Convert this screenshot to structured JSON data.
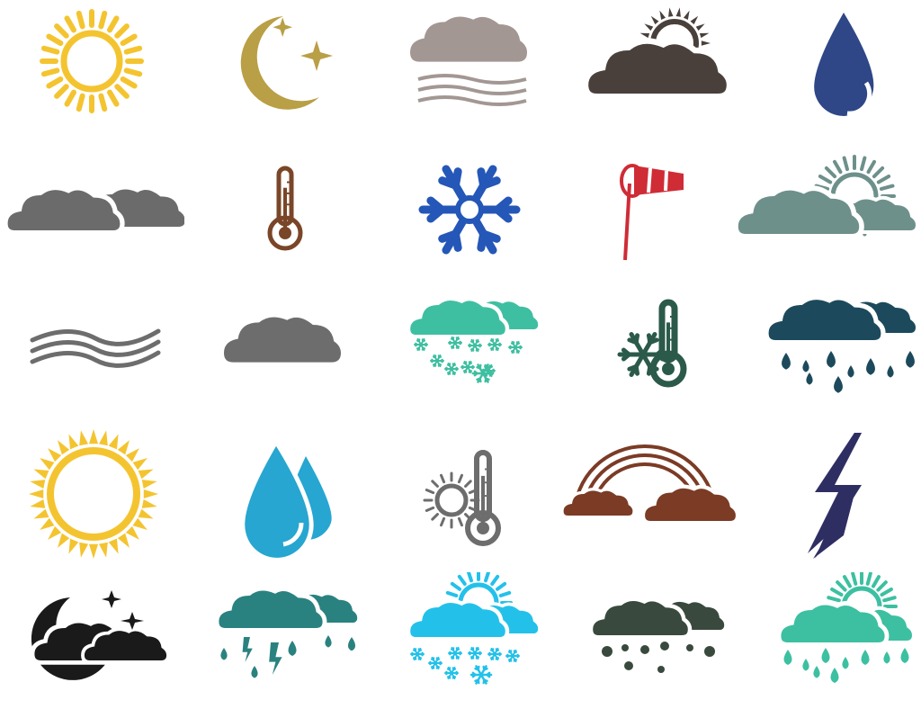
{
  "sheet": {
    "background": "#ffffff",
    "rows": 5,
    "columns": 5
  },
  "icons": [
    {
      "name": "sun-icon",
      "color": "#f4c430"
    },
    {
      "name": "crescent-moon-stars-icon",
      "color": "#b99f45"
    },
    {
      "name": "fog-cloud-icon",
      "color": "#a39793"
    },
    {
      "name": "cloud-sun-icon",
      "color": "#4a403b"
    },
    {
      "name": "water-drop-icon",
      "color": "#2f4687"
    },
    {
      "name": "overcast-clouds-icon",
      "color": "#6b6b6b"
    },
    {
      "name": "thermometer-icon",
      "color": "#7a4628"
    },
    {
      "name": "snowflake-icon",
      "color": "#2457b7"
    },
    {
      "name": "windsock-icon",
      "color": "#cf2c36"
    },
    {
      "name": "partly-cloudy-icon",
      "color": "#6e908b"
    },
    {
      "name": "wind-waves-icon",
      "color": "#6d6d6d"
    },
    {
      "name": "cloud-icon",
      "color": "#6d6d6d"
    },
    {
      "name": "snowy-clouds-icon",
      "color": "#3fbfa1"
    },
    {
      "name": "frost-thermometer-icon",
      "color": "#2b5a4a"
    },
    {
      "name": "rainy-clouds-icon",
      "color": "#1c4a5c"
    },
    {
      "name": "bright-sun-icon",
      "color": "#f4c430"
    },
    {
      "name": "water-drops-icon",
      "color": "#26a6d1"
    },
    {
      "name": "sun-thermometer-icon",
      "color": "#6d6d6d"
    },
    {
      "name": "rainbow-clouds-icon",
      "color": "#7b3b25"
    },
    {
      "name": "lightning-bolt-icon",
      "color": "#2f2e63"
    },
    {
      "name": "night-cloud-moon-icon",
      "color": "#1a1a1a"
    },
    {
      "name": "thunderstorm-rain-icon",
      "color": "#2a8280"
    },
    {
      "name": "sun-snow-clouds-icon",
      "color": "#23c1ea"
    },
    {
      "name": "hail-clouds-icon",
      "color": "#39493e"
    },
    {
      "name": "sun-rain-clouds-icon",
      "color": "#3cc0a1"
    }
  ]
}
